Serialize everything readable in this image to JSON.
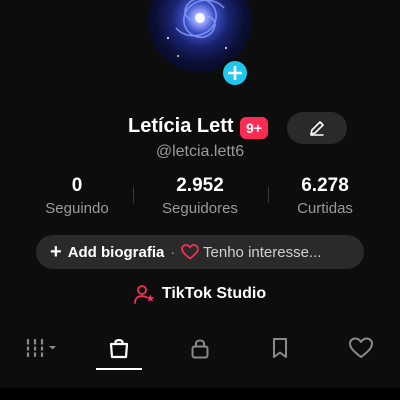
{
  "profile": {
    "name": "Letícia Lett",
    "notification_badge": "9+",
    "handle": "@letcia.lett6"
  },
  "stats": [
    {
      "value": "0",
      "label": "Seguindo"
    },
    {
      "value": "2.952",
      "label": "Seguidores"
    },
    {
      "value": "6.278",
      "label": "Curtidas"
    }
  ],
  "bio_row": {
    "add_bio_label": "Add biografia",
    "separator": "·",
    "interests_label": "Tenho interesse..."
  },
  "studio": {
    "label": "TikTok Studio"
  },
  "tabs": {
    "icons": [
      "videos-grid-icon",
      "shopping-bag-icon",
      "lock-icon",
      "bookmark-icon",
      "heart-icon"
    ],
    "active": "shopping-bag-icon"
  },
  "colors": {
    "background": "#0d0d0d",
    "accent_red": "#fe2c55",
    "accent_cyan": "#20c8ee",
    "button_bg": "#2a2a2a",
    "muted_text": "#9b9b9b"
  }
}
